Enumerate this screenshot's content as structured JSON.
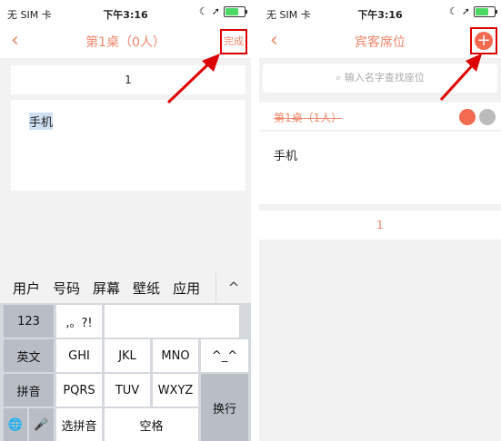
{
  "left": {
    "status": {
      "carrier": "无 SIM 卡",
      "time": "下午3:16"
    },
    "nav": {
      "back": "‹",
      "title": "第1桌（0人）",
      "done": "完成"
    },
    "number_row": "1",
    "item": "手机",
    "candidates": [
      "用户",
      "号码",
      "屏幕",
      "壁纸",
      "应用"
    ],
    "candidates_toggle": "^",
    "keys": {
      "k123": "123",
      "punct": ",。?!",
      "english": "英文",
      "ghi": "GHI",
      "jkl": "JKL",
      "mno": "MNO",
      "emoji": "^_^",
      "pinyin": "拼音",
      "pqrs": "PQRS",
      "tuv": "TUV",
      "wxyz": "WXYZ",
      "enter": "换行",
      "choose_pinyin": "选拼音",
      "space": "空格"
    }
  },
  "right": {
    "status": {
      "carrier": "无 SIM 卡",
      "time": "下午3:16"
    },
    "nav": {
      "back": "‹",
      "title": "宾客席位",
      "add": "+"
    },
    "search_placeholder": "输入名字查找座位",
    "table_label": "第1桌（1人）",
    "item": "手机",
    "number_row": "1"
  },
  "colors": {
    "accent": "#f0866b",
    "highlight": "#d00"
  }
}
